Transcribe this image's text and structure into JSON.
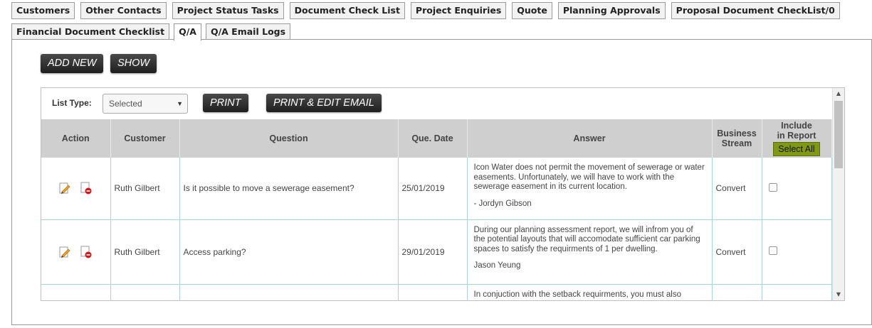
{
  "tabs_row1": [
    "Customers",
    "Other Contacts",
    "Project Status Tasks",
    "Document Check List",
    "Project Enquiries",
    "Quote",
    "Planning Approvals",
    "Proposal Document CheckList/0"
  ],
  "tabs_row2": [
    "Financial Document Checklist",
    "Q/A",
    "Q/A Email Logs"
  ],
  "active_tab": "Q/A",
  "buttons": {
    "add_new": "ADD NEW",
    "show": "SHOW",
    "print": "PRINT",
    "print_edit_email": "PRINT & EDIT EMAIL"
  },
  "list_type": {
    "label": "List Type:",
    "value": "Selected"
  },
  "table": {
    "headers": {
      "action": "Action",
      "customer": "Customer",
      "question": "Question",
      "date": "Que. Date",
      "answer": "Answer",
      "stream_1": "Business",
      "stream_2": "Stream",
      "include_1": "Include",
      "include_2": "in Report",
      "select_all": "Select All"
    },
    "rows": [
      {
        "customer": "Ruth Gilbert",
        "question": "Is it possible to move a sewerage easement?",
        "date": "25/01/2019",
        "answer": "Icon Water does not permit the movement of sewerage or water easements.  Unfortunately, we will have to work with the sewerage easement in its current location.",
        "signature": "- Jordyn Gibson",
        "stream": "Convert",
        "include": false
      },
      {
        "customer": "Ruth Gilbert",
        "question": "Access parking?",
        "date": "29/01/2019",
        "answer": "During our planning assessment report, we will infrom you of the potential layouts that will accomodate sufficient car parking spaces to satisfy the requirments of 1 per dwelling.",
        "signature": "Jason Yeung",
        "stream": "Convert",
        "include": false
      },
      {
        "customer": "",
        "question": "",
        "date": "",
        "answer": "In conjuction with the setback requirments, you must also",
        "signature": "",
        "stream": "",
        "include": false
      }
    ]
  },
  "colors": {
    "header_bg": "#cfcfcf",
    "select_all_bg": "#7f9a12",
    "row_border": "#a9d4d0"
  }
}
